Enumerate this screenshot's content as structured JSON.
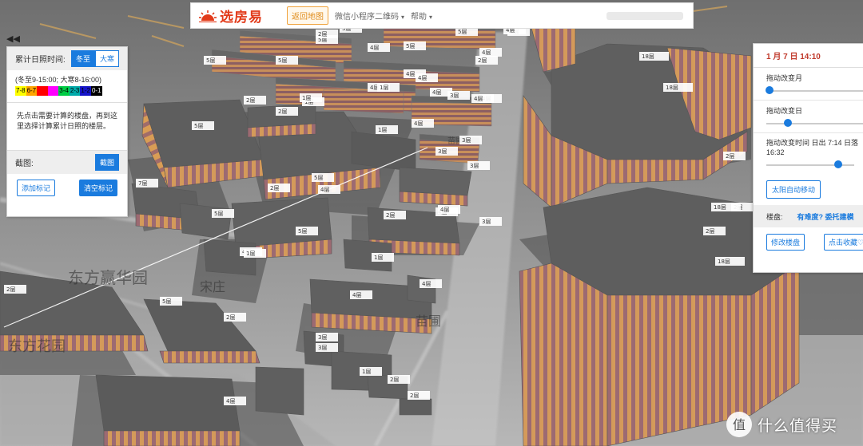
{
  "nav": {
    "logo_text": "选房易",
    "back_map": "返回地图",
    "wechat_qr": "微信小程序二维码",
    "help": "帮助",
    "caret": "▾"
  },
  "left_panel": {
    "collapse_glyph": "◀◀",
    "sunlight_label": "累计日照时间:",
    "winter_btn": "冬至",
    "cold_btn": "大寒",
    "range_text": "(冬至9-15:00; 大寒8-16:00)",
    "legend": [
      {
        "label": "7-8",
        "bg": "#ffff00",
        "fg": "#000000"
      },
      {
        "label": "6-7",
        "bg": "#ffa500",
        "fg": "#000000"
      },
      {
        "label": "5-6",
        "bg": "#ff0000",
        "fg": "#ff0000"
      },
      {
        "label": "4-5",
        "bg": "#ff00ff",
        "fg": "#ff00ff"
      },
      {
        "label": "3-4",
        "bg": "#00cc44",
        "fg": "#000000"
      },
      {
        "label": "2-3",
        "bg": "#00aaaa",
        "fg": "#000000"
      },
      {
        "label": "1-2",
        "bg": "#1515c8",
        "fg": "#000000"
      },
      {
        "label": "0-1",
        "bg": "#000000",
        "fg": "#ffffff"
      }
    ],
    "hint": "先点击需要计算的楼盘，再到这里选择计算累计日照的楼层。",
    "screenshot_label": "截图:",
    "screenshot_btn": "截图",
    "add_mark": "添加标记",
    "clear_mark": "清空标记"
  },
  "right_panel": {
    "date": "1 月 7 日 14:10",
    "drag_month": "拖动改变月",
    "drag_day": "拖动改变日",
    "drag_time": "拖动改变时间 日出 7:14 日落 16:32",
    "month_level": 0.03,
    "day_level": 0.19,
    "time_level": 0.64,
    "sun_auto": "太阳自动移动",
    "building_label": "楼盘:",
    "building_link": "有难度? 委托建模",
    "edit_building": "修改楼盘",
    "favorite": "点击收藏♡"
  },
  "floor_labels": [
    "5层",
    "3层",
    "5层",
    "5层",
    "5层",
    "4层",
    "5层",
    "4层",
    "5层",
    "2层",
    "4层",
    "4层",
    "4层",
    "4层",
    "3层",
    "1层",
    "1层",
    "1层",
    "2层",
    "2层",
    "4层",
    "1层",
    "5层",
    "4层",
    "3层",
    "5层",
    "7层",
    "4层",
    "2层",
    "3层",
    "4层",
    "2层",
    "4层",
    "5层",
    "1层",
    "5层",
    "5层",
    "4层",
    "2层",
    "4层",
    "3层",
    "4层",
    "1层",
    "2层",
    "2层",
    "3层",
    "1层",
    "4层",
    "2层",
    "18层",
    "18层",
    "18层",
    "2层",
    "2层",
    "2层",
    "18层",
    "18层",
    "2层",
    "4层",
    "3层",
    "3层",
    "4层"
  ],
  "map_text": [
    "东方赢华园",
    "苗圃",
    "宋庄",
    "苗圃路",
    "东方花园"
  ],
  "watermark": "什么值得买",
  "watermark_badge": "值",
  "colors": {
    "accent": "#1a7bde",
    "logo": "#e23b1a",
    "date": "#c0392b",
    "building_stripe_a": "#d49a5a",
    "building_stripe_b": "#9c6a72",
    "roof": "#5e5e5e"
  }
}
